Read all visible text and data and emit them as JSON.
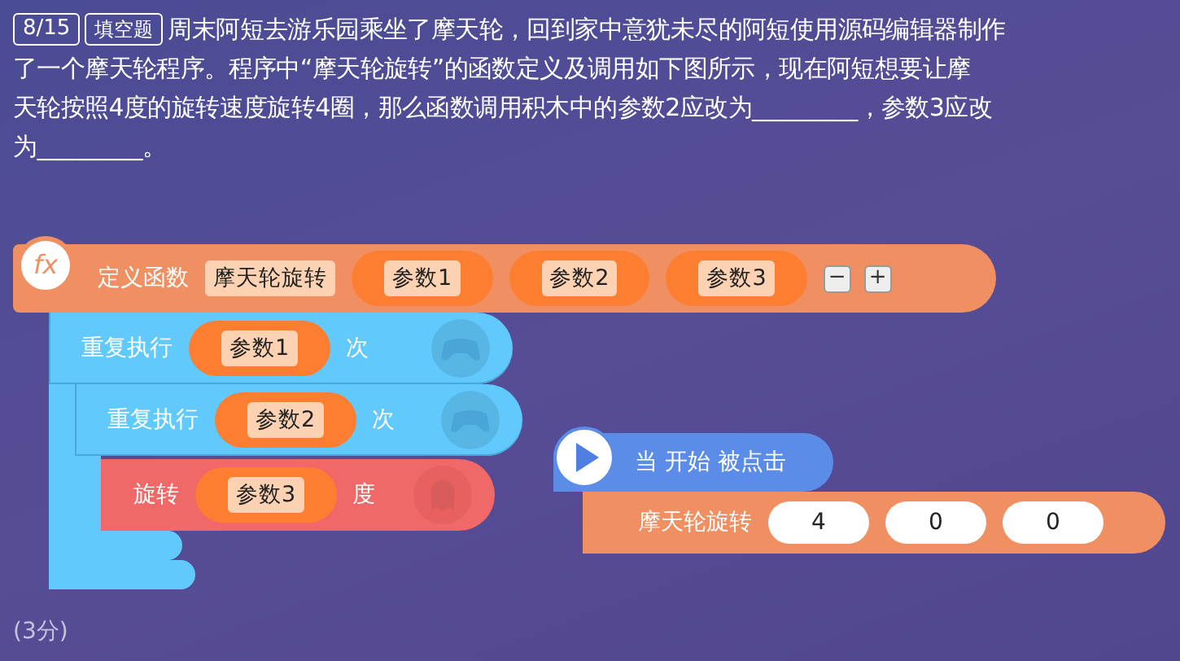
{
  "header": {
    "number": "8/15",
    "type": "填空题"
  },
  "question_lines": [
    "周末阿短去游乐园乘坐了摩天轮，回到家中意犹未尽的阿短使用源码编辑器制作",
    "了一个摩天轮程序。程序中“摩天轮旋转”的函数定义及调用如下图所示，现在阿短想要让摩",
    "天轮按照4度的旋转速度旋转4圈，那么函数调用积木中的参数2应改为_________，参数3应改",
    "为_________。"
  ],
  "define_block": {
    "icon": "fx",
    "label": "定义函数",
    "name": "摩天轮旋转",
    "params": [
      "参数1",
      "参数2",
      "参数3"
    ],
    "buttons": [
      "−",
      "+"
    ]
  },
  "outer_repeat": {
    "label": "重复执行",
    "param": "参数1",
    "suffix": "次"
  },
  "inner_repeat": {
    "label": "重复执行",
    "param": "参数2",
    "suffix": "次"
  },
  "turn_block": {
    "label": "旋转",
    "param": "参数3",
    "suffix": "度"
  },
  "event_block": {
    "label": "当 开始 被点击"
  },
  "call_block": {
    "label": "摩天轮旋转",
    "values": [
      "4",
      "0",
      "0"
    ]
  },
  "score": "(3分)"
}
